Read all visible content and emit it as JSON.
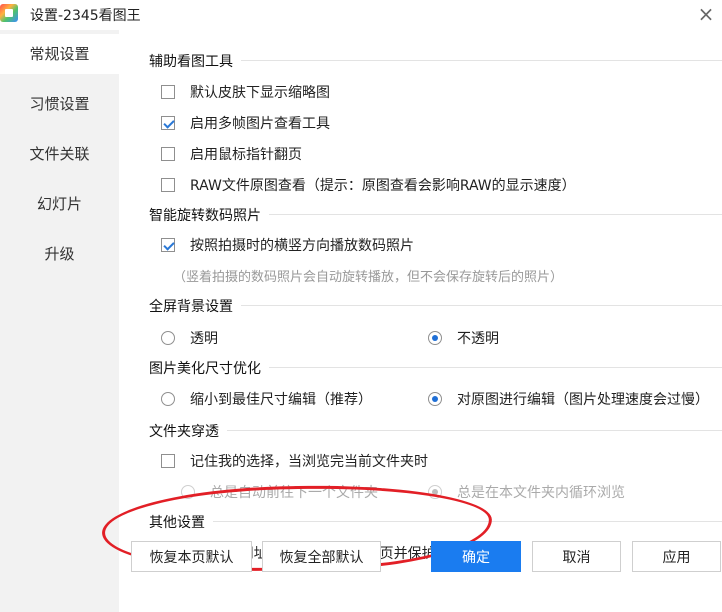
{
  "window": {
    "title": "设置-2345看图王",
    "close_icon": "×"
  },
  "sidebar": {
    "items": [
      {
        "label": "常规设置",
        "active": true
      },
      {
        "label": "习惯设置"
      },
      {
        "label": "文件关联"
      },
      {
        "label": "幻灯片"
      },
      {
        "label": "升级"
      }
    ]
  },
  "sections": {
    "viewer_tools": {
      "title": "辅助看图工具",
      "options": [
        {
          "label": "默认皮肤下显示缩略图",
          "checked": false
        },
        {
          "label": "启用多帧图片查看工具",
          "checked": true
        },
        {
          "label": "启用鼠标指针翻页",
          "checked": false
        },
        {
          "label": "RAW文件原图查看（提示：原图查看会影响RAW的显示速度）",
          "checked": false
        }
      ]
    },
    "rotate": {
      "title": "智能旋转数码照片",
      "option": {
        "label": "按照拍摄时的横竖方向播放数码照片",
        "checked": true
      },
      "hint": "（竖着拍摄的数码照片会自动旋转播放，但不会保存旋转后的照片）"
    },
    "fullscreen_bg": {
      "title": "全屏背景设置",
      "options": [
        {
          "label": "透明",
          "checked": false
        },
        {
          "label": "不透明",
          "checked": true
        }
      ]
    },
    "beautify": {
      "title": "图片美化尺寸优化",
      "options": [
        {
          "label": "缩小到最佳尺寸编辑（推荐）",
          "checked": false
        },
        {
          "label": "对原图进行编辑（图片处理速度会过慢）",
          "checked": true
        }
      ]
    },
    "folder": {
      "title": "文件夹穿透",
      "option": {
        "label": "记住我的选择，当浏览完当前文件夹时",
        "checked": false
      },
      "sub_options": [
        {
          "label": "总是自动前往下一个文件夹",
          "checked": false
        },
        {
          "label": "总是在本文件夹内循环浏览",
          "checked": true
        }
      ]
    },
    "other": {
      "title": "其他设置",
      "option": {
        "label": "将2345网址导航设为浏览器主页并保护",
        "checked": false
      }
    }
  },
  "buttons": {
    "restore_page": "恢复本页默认",
    "restore_all": "恢复全部默认",
    "ok": "确定",
    "cancel": "取消",
    "apply": "应用"
  },
  "colors": {
    "primary": "#1a7cf0",
    "annotation": "#e21f26",
    "sidebar_bg": "#f2f2f2"
  }
}
